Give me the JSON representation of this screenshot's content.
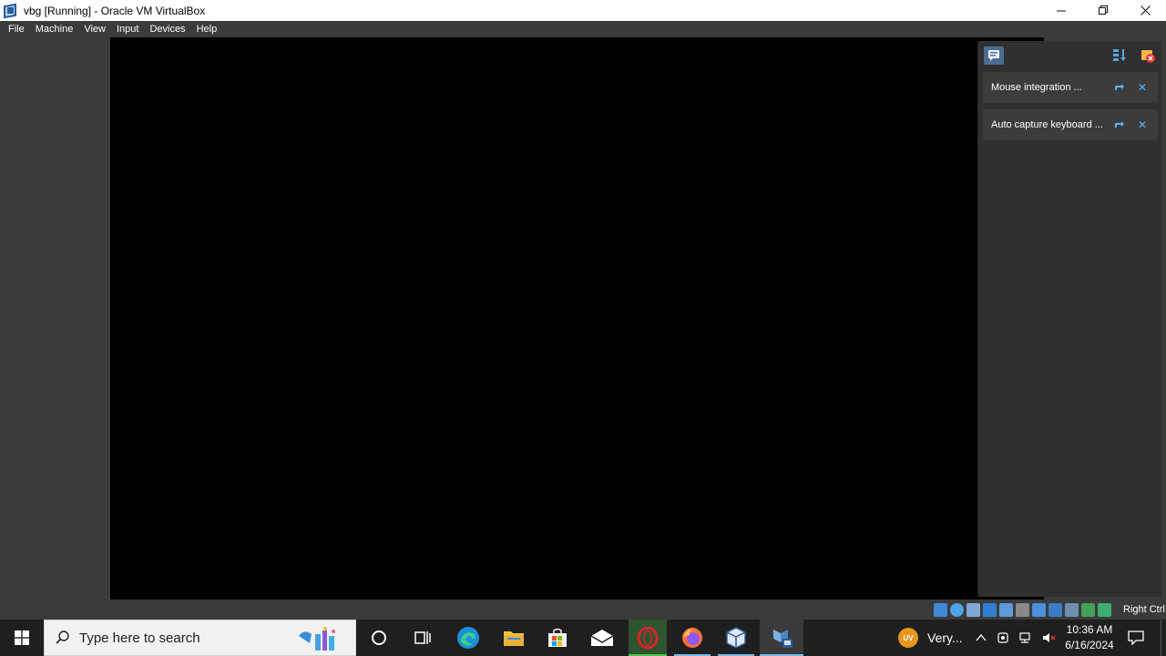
{
  "window": {
    "title": "vbg [Running] - Oracle VM VirtualBox",
    "minimize_icon": "minimize-icon",
    "maximize_icon": "restore-icon",
    "close_icon": "close-icon"
  },
  "menubar": {
    "items": [
      "File",
      "Machine",
      "View",
      "Input",
      "Devices",
      "Help"
    ]
  },
  "notification_center": {
    "items": [
      {
        "text": "Mouse integration ..."
      },
      {
        "text": "Auto capture keyboard ..."
      }
    ]
  },
  "statusbar": {
    "host_key": "Right Ctrl",
    "icons": [
      "hard-disk-icon",
      "optical-disk-icon",
      "audio-icon",
      "network-icon",
      "usb-icon",
      "shared-folders-icon",
      "display-icon",
      "recording-icon",
      "cpu-icon",
      "mouse-integration-icon",
      "keyboard-icon"
    ]
  },
  "taskbar": {
    "search_placeholder": "Type here to search",
    "pinned": [
      "cortana-icon",
      "task-view-icon",
      "edge-icon",
      "file-explorer-icon",
      "store-icon",
      "mail-icon",
      "opera-icon",
      "firefox-icon",
      "virtualbox-icon",
      "virtualbox-vm-icon"
    ],
    "weather_badge": "UV",
    "weather_text": "Very...",
    "time": "10:36 AM",
    "date": "6/16/2024"
  },
  "colors": {
    "accent": "#76b9ed",
    "close_x": "#57b4ff",
    "weather": "#e8961e"
  }
}
